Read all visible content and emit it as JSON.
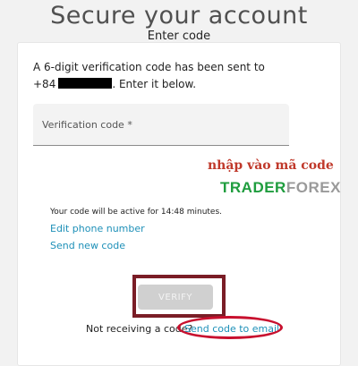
{
  "header": {
    "title": "Secure your account"
  },
  "card": {
    "title": "Enter code",
    "info_line1": "A 6-digit verification code has been sent to",
    "phone_prefix": "+84",
    "info_line2_suffix": ". Enter it below.",
    "code_field": {
      "label": "Verification code *",
      "value": ""
    },
    "annotation": "nhập vào mã code",
    "watermark": {
      "part1": "TRADER",
      "part2": "FOREX"
    },
    "active_note": "Your code will be active for 14:48 minutes.",
    "edit_phone_link": "Edit phone number",
    "send_new_link": "Send new code",
    "verify_button": "VERIFY",
    "not_receiving": "Not receiving a code?",
    "email_link": "Send code to email"
  },
  "colors": {
    "link": "#1e90b8",
    "highlight_box": "#7a1d26",
    "highlight_ellipse": "#c8102e",
    "annotation": "#c0392b"
  }
}
